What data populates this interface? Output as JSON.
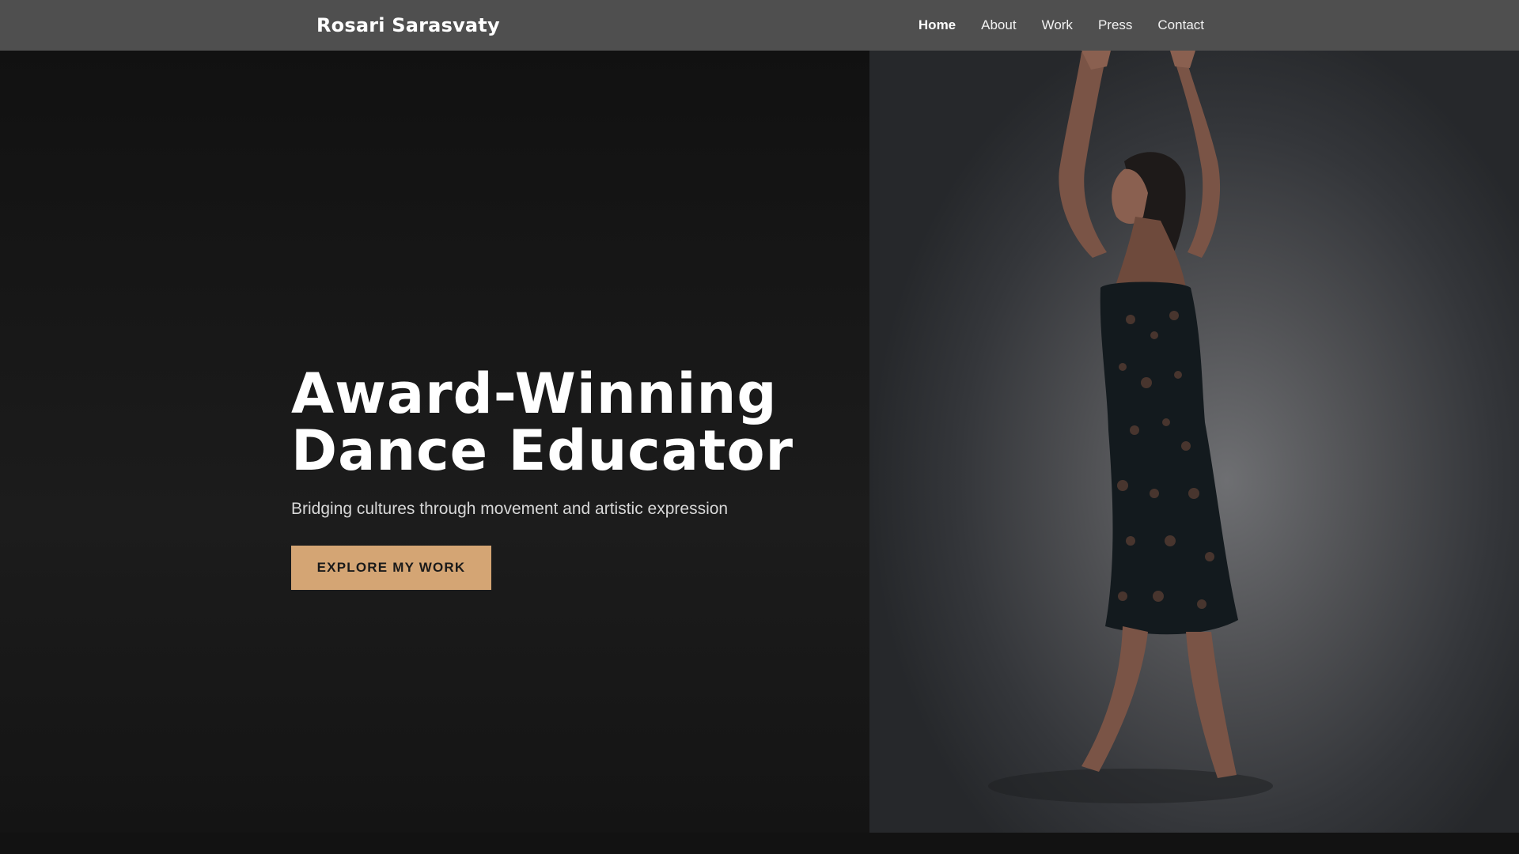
{
  "header": {
    "brand": "Rosari Sarasvaty",
    "nav": [
      {
        "label": "Home",
        "active": true
      },
      {
        "label": "About",
        "active": false
      },
      {
        "label": "Work",
        "active": false
      },
      {
        "label": "Press",
        "active": false
      },
      {
        "label": "Contact",
        "active": false
      }
    ]
  },
  "hero": {
    "headline_line1": "Award-Winning",
    "headline_line2": "Dance Educator",
    "subtitle": "Bridging cultures through movement and artistic expression",
    "cta_label": "EXPLORE MY WORK"
  },
  "colors": {
    "navbar_bg": "#4f4f4f",
    "page_bg": "#131313",
    "accent": "#d4a574"
  }
}
